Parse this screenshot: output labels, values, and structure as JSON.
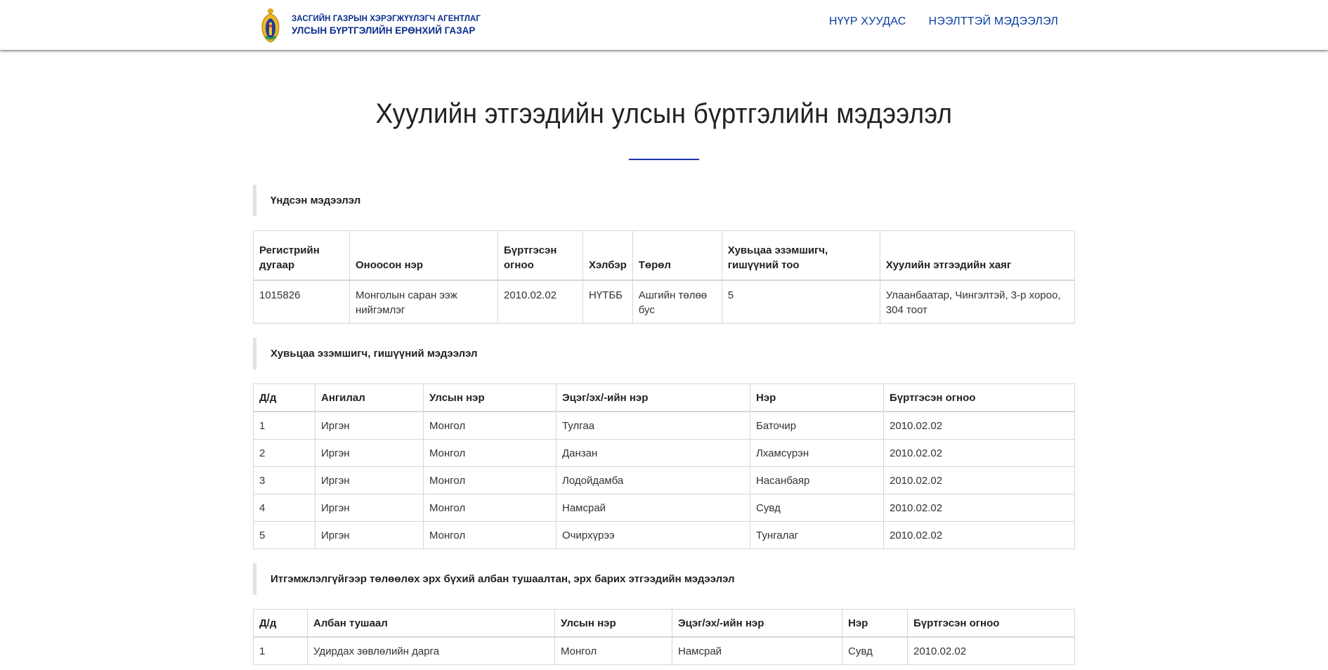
{
  "header": {
    "agency_line1": "ЗАСГИЙН ГАЗРЫН ХЭРЭГЖҮҮЛЭГЧ АГЕНТЛАГ",
    "agency_line2": "УЛСЫН БҮРТГЭЛИЙН ЕРӨНХИЙ ГАЗАР",
    "nav": [
      {
        "label": "НҮҮР ХУУДАС"
      },
      {
        "label": "НЭЭЛТТЭЙ МЭДЭЭЛЭЛ"
      }
    ]
  },
  "page": {
    "title": "Хуулийн этгээдийн улсын бүртгэлийн мэдээлэл"
  },
  "basic": {
    "section_title": "Үндсэн мэдээлэл",
    "headers": [
      "Регистрийн дугаар",
      "Оноосон нэр",
      "Бүртгэсэн огноо",
      "Хэлбэр",
      "Төрөл",
      "Хувьцаа эзэмшигч, гишүүний тоо",
      "Хуулийн этгээдийн хаяг"
    ],
    "rows": [
      [
        "1015826",
        "Монголын саран ээж нийгэмлэг",
        "2010.02.02",
        "НҮТББ",
        "Ашгийн төлөө бус",
        "5",
        "Улаанбаатар, Чингэлтэй, 3-р хороо, 304 тоот"
      ]
    ]
  },
  "members": {
    "section_title": "Хувьцаа эзэмшигч, гишүүний мэдээлэл",
    "headers": [
      "Д/д",
      "Ангилал",
      "Улсын нэр",
      "Эцэг/эх/-ийн нэр",
      "Нэр",
      "Бүртгэсэн огноо"
    ],
    "rows": [
      [
        "1",
        "Иргэн",
        "Монгол",
        "Тулгаа",
        "Баточир",
        "2010.02.02"
      ],
      [
        "2",
        "Иргэн",
        "Монгол",
        "Данзан",
        "Лхамсүрэн",
        "2010.02.02"
      ],
      [
        "3",
        "Иргэн",
        "Монгол",
        "Лодойдамба",
        "Насанбаяр",
        "2010.02.02"
      ],
      [
        "4",
        "Иргэн",
        "Монгол",
        "Намсрай",
        "Сувд",
        "2010.02.02"
      ],
      [
        "5",
        "Иргэн",
        "Монгол",
        "Очирхүрээ",
        "Тунгалаг",
        "2010.02.02"
      ]
    ]
  },
  "officials": {
    "section_title": "Итгэмжлэлгүйгээр төлөөлөх эрх бүхий албан тушаалтан, эрх барих этгээдийн мэдээлэл",
    "headers": [
      "Д/д",
      "Албан тушаал",
      "Улсын нэр",
      "Эцэг/эх/-ийн нэр",
      "Нэр",
      "Бүртгэсэн огноо"
    ],
    "rows": [
      [
        "1",
        "Удирдах зөвлөлийн дарга",
        "Монгол",
        "Намсрай",
        "Сувд",
        "2010.02.02"
      ]
    ]
  },
  "icons": {
    "logo": "mongolia-state-emblem-icon"
  },
  "colors": {
    "brand_blue": "#0a2e8f",
    "nav_link": "#0a3fa0",
    "title_rule": "#1a34a8"
  }
}
